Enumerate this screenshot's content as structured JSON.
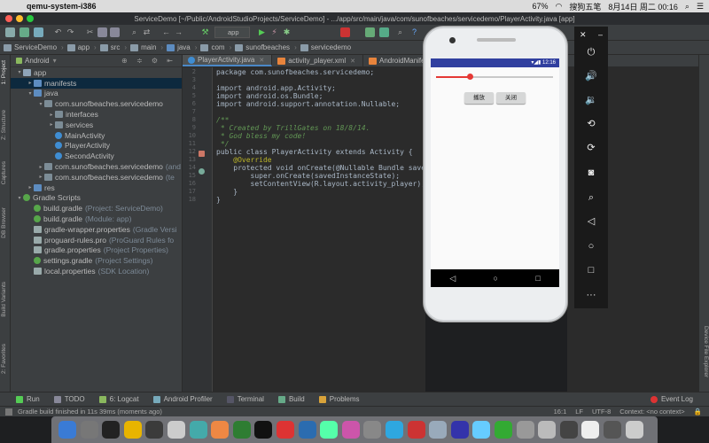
{
  "menubar": {
    "app_name": "qemu-system-i386",
    "battery": "67%",
    "im": "搜狗五笔",
    "datetime": "8月14日 周二 00:16"
  },
  "window": {
    "title": "ServiceDemo [~/Public/AndroidStudioProjects/ServiceDemo] - .../app/src/main/java/com/sunofbeaches/servicedemo/PlayerActivity.java [app]"
  },
  "toolbar": {
    "run_config": "app"
  },
  "breadcrumbs": [
    "ServiceDemo",
    "app",
    "src",
    "main",
    "java",
    "com",
    "sunofbeaches",
    "servicedemo"
  ],
  "project": {
    "view_mode": "Android",
    "tree": [
      {
        "label": "app",
        "suffix": "",
        "icon": "folder",
        "depth": 0,
        "arrow": "▾"
      },
      {
        "label": "manifests",
        "suffix": "",
        "icon": "folder-blue",
        "depth": 1,
        "arrow": "▸",
        "selected": true
      },
      {
        "label": "java",
        "suffix": "",
        "icon": "folder-blue",
        "depth": 1,
        "arrow": "▾"
      },
      {
        "label": "com.sunofbeaches.servicedemo",
        "suffix": "",
        "icon": "pkg",
        "depth": 2,
        "arrow": "▾"
      },
      {
        "label": "interfaces",
        "suffix": "",
        "icon": "pkg",
        "depth": 3,
        "arrow": "▸"
      },
      {
        "label": "services",
        "suffix": "",
        "icon": "pkg",
        "depth": 3,
        "arrow": "▸"
      },
      {
        "label": "MainActivity",
        "suffix": "",
        "icon": "cls",
        "depth": 3,
        "arrow": ""
      },
      {
        "label": "PlayerActivity",
        "suffix": "",
        "icon": "cls",
        "depth": 3,
        "arrow": ""
      },
      {
        "label": "SecondActivity",
        "suffix": "",
        "icon": "cls",
        "depth": 3,
        "arrow": ""
      },
      {
        "label": "com.sunofbeaches.servicedemo",
        "suffix": "(and",
        "icon": "pkg",
        "depth": 2,
        "arrow": "▸"
      },
      {
        "label": "com.sunofbeaches.servicedemo",
        "suffix": "(te",
        "icon": "pkg",
        "depth": 2,
        "arrow": "▸"
      },
      {
        "label": "res",
        "suffix": "",
        "icon": "folder-blue",
        "depth": 1,
        "arrow": "▸"
      },
      {
        "label": "Gradle Scripts",
        "suffix": "",
        "icon": "gradle",
        "depth": 0,
        "arrow": "▾"
      },
      {
        "label": "build.gradle",
        "suffix": "(Project: ServiceDemo)",
        "icon": "gradle",
        "depth": 1,
        "arrow": ""
      },
      {
        "label": "build.gradle",
        "suffix": "(Module: app)",
        "icon": "gradle",
        "depth": 1,
        "arrow": ""
      },
      {
        "label": "gradle-wrapper.properties",
        "suffix": "(Gradle Versi",
        "icon": "file",
        "depth": 1,
        "arrow": ""
      },
      {
        "label": "proguard-rules.pro",
        "suffix": "(ProGuard Rules fo",
        "icon": "file",
        "depth": 1,
        "arrow": ""
      },
      {
        "label": "gradle.properties",
        "suffix": "(Project Properties)",
        "icon": "file",
        "depth": 1,
        "arrow": ""
      },
      {
        "label": "settings.gradle",
        "suffix": "(Project Settings)",
        "icon": "gradle",
        "depth": 1,
        "arrow": ""
      },
      {
        "label": "local.properties",
        "suffix": "(SDK Location)",
        "icon": "file",
        "depth": 1,
        "arrow": ""
      }
    ]
  },
  "side_tabs": {
    "left": [
      "1: Project",
      "Z: Structure",
      "Captures",
      "DB Browser",
      "Build Variants",
      "2: Favorites"
    ],
    "right": [
      "Device File Explorer"
    ]
  },
  "editor": {
    "tabs": [
      {
        "label": "PlayerActivity.java",
        "active": true
      },
      {
        "label": "activity_player.xml",
        "active": false
      },
      {
        "label": "AndroidManifest.xml",
        "active": false
      }
    ],
    "line_numbers": [
      "2",
      "3",
      "4",
      "5",
      "6",
      "7",
      "8",
      "9",
      "10",
      "11",
      "12",
      "13",
      "14",
      "15",
      "16",
      "17",
      "18"
    ],
    "code": {
      "l1": "package com.sunofbeaches.servicedemo;",
      "l3": "import android.app.Activity;",
      "l4": "import android.os.Bundle;",
      "l5": "import android.support.annotation.Nullable;",
      "l7": "/**",
      "l8": " * Created by TrillGates on 18/8/14.",
      "l9": " * God bless my code!",
      "l10": " */",
      "l11": "public class PlayerActivity extends Activity {",
      "l12": "    @Override",
      "l13": "    protected void onCreate(@Nullable Bundle savedInst",
      "l14": "        super.onCreate(savedInstanceState);",
      "l15": "        setContentView(R.layout.activity_player);",
      "l16": "    }",
      "l17": "}"
    }
  },
  "emulator": {
    "time": "12:16",
    "play_button": "播放",
    "stop_button": "关闭",
    "seek_progress": 0.29
  },
  "bottom_tabs": [
    "Run",
    "TODO",
    "6: Logcat",
    "Android Profiler",
    "Terminal",
    "Build",
    "Problems"
  ],
  "event_log": "Event Log",
  "status": {
    "message": "Gradle build finished in 11s 39ms (moments ago)",
    "position": "16:1",
    "line_sep": "LF",
    "encoding": "UTF-8",
    "context": "Context: <no context>"
  }
}
